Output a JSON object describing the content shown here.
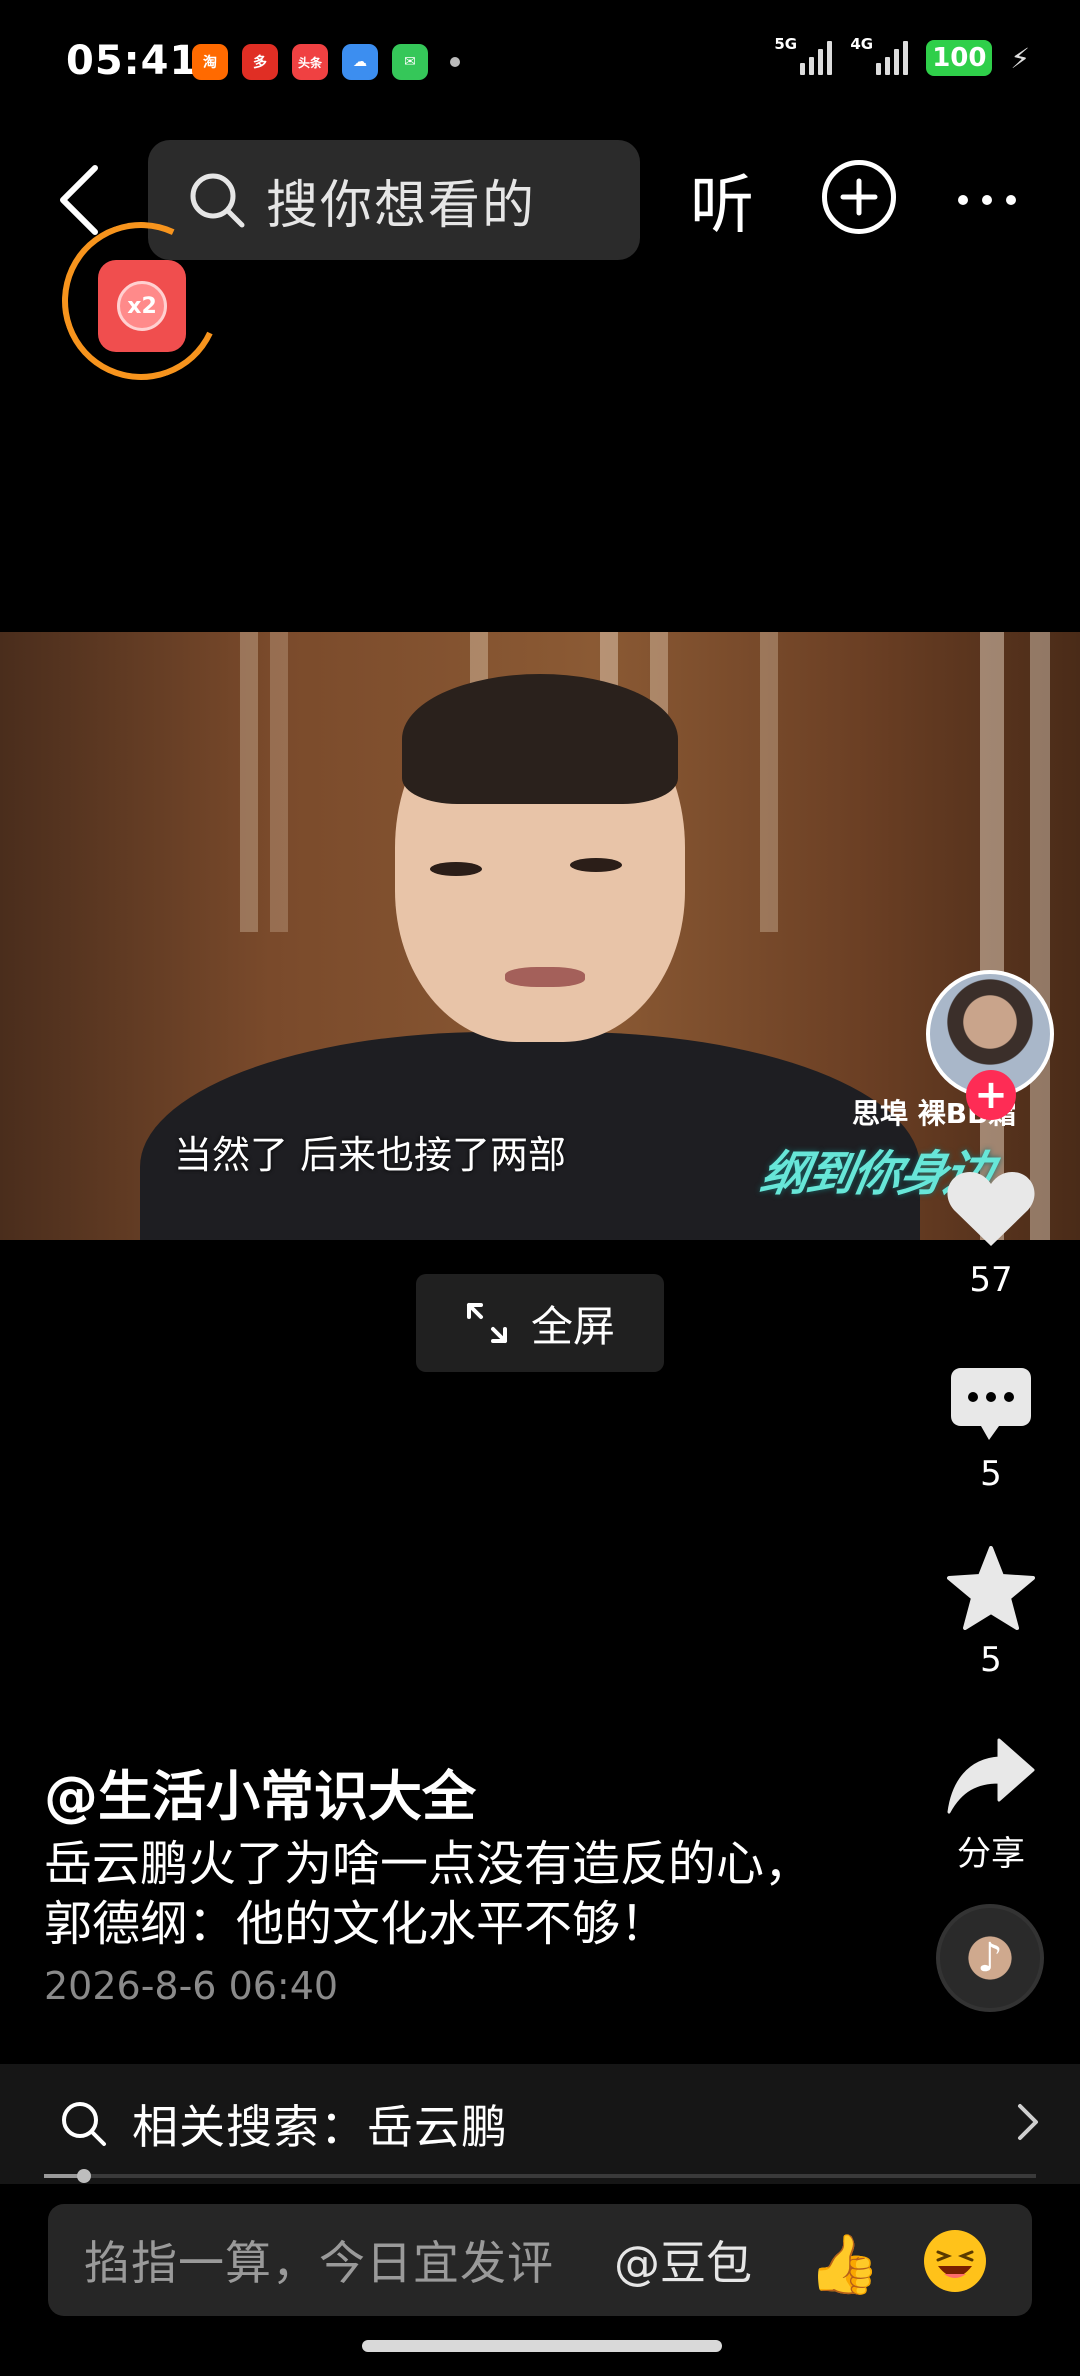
{
  "status_bar": {
    "time": "05:41",
    "apps": [
      {
        "name": "taobao-icon",
        "label": "淘",
        "color": "#ff6a00"
      },
      {
        "name": "pinduoduo-icon",
        "label": "多",
        "color": "#e02e24"
      },
      {
        "name": "toutiao-icon",
        "label": "头条",
        "color": "#f04142"
      },
      {
        "name": "weather-icon",
        "label": "☁",
        "color": "#3c8ef0"
      },
      {
        "name": "messages-icon",
        "label": "✉",
        "color": "#35c759"
      }
    ],
    "signal_1": "5G",
    "signal_2": "4G",
    "battery": "100"
  },
  "top_nav": {
    "search_placeholder": "搜你想看的",
    "listen_label": "听"
  },
  "red_packet": {
    "multiplier": "x2"
  },
  "video": {
    "subtitle": "当然了 后来也接了两部",
    "logo_top": "思埠 裸BB霜",
    "logo_main": "纲到你身边"
  },
  "fullscreen": {
    "label": "全屏"
  },
  "rail": {
    "likes": "57",
    "comments": "5",
    "favorites": "5",
    "share_label": "分享"
  },
  "caption": {
    "author": "@生活小常识大全",
    "description": "岳云鹏火了为啥一点没有造反的心，郭德纲：他的文化水平不够！",
    "timestamp": "2026-8-6 06:40"
  },
  "related_search": {
    "text": "相关搜索：岳云鹏"
  },
  "progress": {
    "fraction": 0.04
  },
  "comment_bar": {
    "placeholder": "掐指一算，今日宜发评",
    "mention": "@豆包"
  }
}
